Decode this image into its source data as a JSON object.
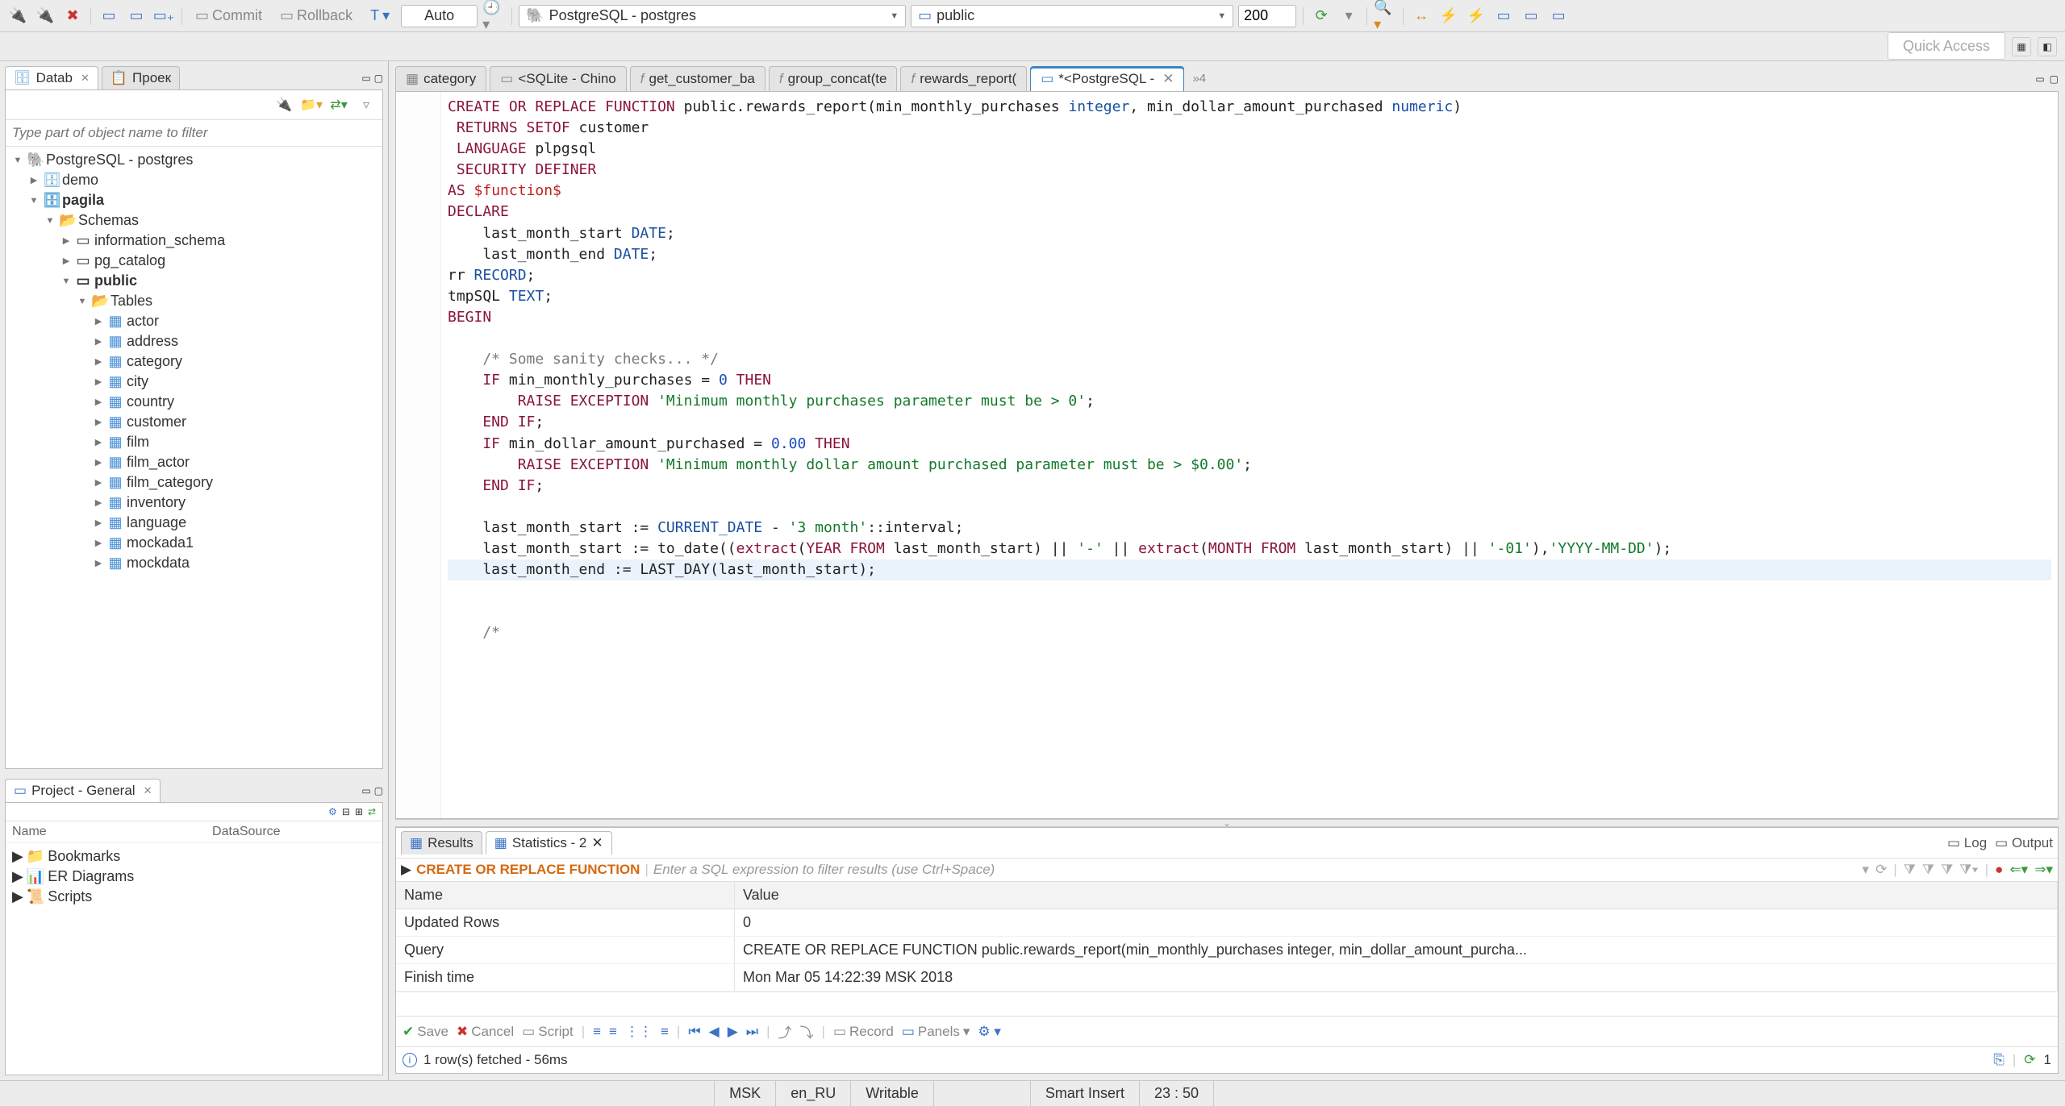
{
  "toolbar": {
    "commit_label": "Commit",
    "rollback_label": "Rollback",
    "tx_label": "T",
    "auto_label": "Auto",
    "connection_label": "PostgreSQL - postgres",
    "schema_label": "public",
    "limit_value": "200"
  },
  "quick_access": {
    "placeholder": "Quick Access"
  },
  "left_panel": {
    "tabs": [
      {
        "label": "Datab",
        "close": "✕"
      },
      {
        "label": "Проек"
      }
    ],
    "filter_placeholder": "Type part of object name to filter",
    "tree": {
      "conn": "PostgreSQL - postgres",
      "db1": "demo",
      "db2": "pagila",
      "schemas_label": "Schemas",
      "schemas": [
        "information_schema",
        "pg_catalog",
        "public"
      ],
      "tables_label": "Tables",
      "tables": [
        "actor",
        "address",
        "category",
        "city",
        "country",
        "customer",
        "film",
        "film_actor",
        "film_category",
        "inventory",
        "language",
        "mockada1",
        "mockdata"
      ]
    }
  },
  "project_panel": {
    "title": "Project - General",
    "cols": {
      "c1": "Name",
      "c2": "DataSource"
    },
    "items": [
      "Bookmarks",
      "ER Diagrams",
      "Scripts"
    ]
  },
  "editor": {
    "tabs": [
      {
        "label": "category",
        "icon": "table"
      },
      {
        "label": "<SQLite - Chino",
        "icon": "sql"
      },
      {
        "label": "get_customer_ba",
        "icon": "func"
      },
      {
        "label": "group_concat(te",
        "icon": "func"
      },
      {
        "label": "rewards_report(",
        "icon": "func"
      },
      {
        "label": "*<PostgreSQL - ",
        "icon": "sql",
        "active": true
      }
    ],
    "overflow": "»4"
  },
  "code": {
    "l01a": "CREATE OR REPLACE FUNCTION",
    "l01b": " public.rewards_report(min_monthly_purchases ",
    "l01c": "integer",
    "l01d": ", min_dollar_amount_purchased ",
    "l01e": "numeric",
    "l01f": ")",
    "l02a": " RETURNS SETOF",
    "l02b": " customer",
    "l03a": " LANGUAGE",
    "l03b": " plpgsql",
    "l04": " SECURITY DEFINER",
    "l05a": "AS ",
    "l05b": "$function$",
    "l06": "DECLARE",
    "l07a": "    last_month_start ",
    "l07b": "DATE",
    "l07c": ";",
    "l08a": "    last_month_end ",
    "l08b": "DATE",
    "l08c": ";",
    "l09a": "rr ",
    "l09b": "RECORD",
    "l09c": ";",
    "l10a": "tmpSQL ",
    "l10b": "TEXT",
    "l10c": ";",
    "l11": "BEGIN",
    "l12": "",
    "l13": "    /* Some sanity checks... */",
    "l14a": "    IF",
    "l14b": " min_monthly_purchases = ",
    "l14c": "0",
    "l14d": " THEN",
    "l15a": "        RAISE EXCEPTION ",
    "l15b": "'Minimum monthly purchases parameter must be > 0'",
    "l15c": ";",
    "l16a": "    END",
    "l16b": " IF",
    "l16c": ";",
    "l17a": "    IF",
    "l17b": " min_dollar_amount_purchased = ",
    "l17c": "0.00",
    "l17d": " THEN",
    "l18a": "        RAISE EXCEPTION ",
    "l18b": "'Minimum monthly dollar amount purchased parameter must be > $0.00'",
    "l18c": ";",
    "l19a": "    END",
    "l19b": " IF",
    "l19c": ";",
    "l20": "",
    "l21a": "    last_month_start := ",
    "l21b": "CURRENT_DATE",
    "l21c": " - ",
    "l21d": "'3 month'",
    "l21e": "::interval;",
    "l22a": "    last_month_start := to_date((",
    "l22b": "extract",
    "l22c": "(",
    "l22d": "YEAR FROM",
    "l22e": " last_month_start) || ",
    "l22f": "'-'",
    "l22g": " || ",
    "l22h": "extract",
    "l22i": "(",
    "l22j": "MONTH FROM",
    "l22k": " last_month_start) || ",
    "l22l": "'-01'",
    "l22m": "),",
    "l22n": "'YYYY-MM-DD'",
    "l22o": ");",
    "l23a": "    last_month_end := LAST_DAY(last_month_start);",
    "l24": "",
    "l25": "    /*"
  },
  "results": {
    "tabs": {
      "results": "Results",
      "stats": "Statistics - 2"
    },
    "right": {
      "log": "Log",
      "output": "Output"
    },
    "filter_sql": "CREATE OR REPLACE FUNCTION",
    "filter_placeholder": "Enter a SQL expression to filter results (use Ctrl+Space)",
    "head": {
      "c1": "Name",
      "c2": "Value"
    },
    "rows": [
      {
        "name": "Updated Rows",
        "value": "0"
      },
      {
        "name": "Query",
        "value": "CREATE OR REPLACE FUNCTION public.rewards_report(min_monthly_purchases integer, min_dollar_amount_purcha..."
      },
      {
        "name": "Finish time",
        "value": "Mon Mar 05 14:22:39 MSK 2018"
      }
    ],
    "toolbar": {
      "save": "Save",
      "cancel": "Cancel",
      "script": "Script",
      "record": "Record",
      "panels": "Panels"
    },
    "status": {
      "text": "1 row(s) fetched - 56ms",
      "rownum": "1"
    }
  },
  "statusbar": {
    "tz": "MSK",
    "locale": "en_RU",
    "mode": "Writable",
    "insert": "Smart Insert",
    "pos": "23 : 50"
  }
}
